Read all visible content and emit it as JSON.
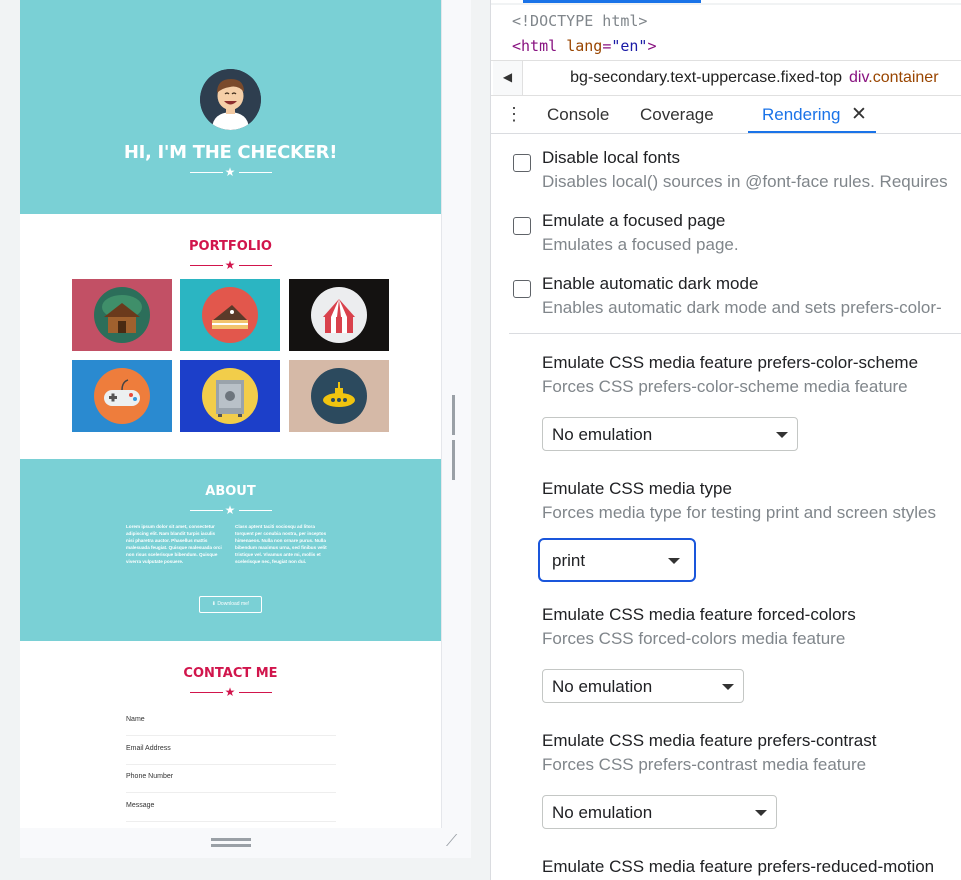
{
  "preview": {
    "hero": {
      "title": "HI, I'M THE CHECKER!",
      "background": "#7ad0d5"
    },
    "portfolio": {
      "title": "PORTFOLIO",
      "tiles": [
        {
          "icon": "cabin-icon",
          "bg": "#c25065"
        },
        {
          "icon": "cake-icon",
          "bg": "#2bb5c2"
        },
        {
          "icon": "circus-tent-icon",
          "bg": "#141211"
        },
        {
          "icon": "game-controller-icon",
          "bg": "#2a8ad0"
        },
        {
          "icon": "safe-icon",
          "bg": "#1c3fc9"
        },
        {
          "icon": "submarine-icon",
          "bg": "#d5b9a7"
        }
      ]
    },
    "about": {
      "title": "ABOUT",
      "col_left": "Lorem ipsum dolor sit amet, consectetur adipiscing elit. Nam blandit turpis iaculis nisi pharetra auctor. Phasellus mattis malesuada feugiat. Quisque malesuada orci non risus scelerisque bibendum. Quisque viverra vulputate posuere.",
      "col_right": "Class aptent taciti sociosqu ad litora torquent per conubia nostra, per inceptos himenaeos. Nulla non ornare purus. Nulla bibendum maximus urna, sed finibus velit tristique vel. Vivamus ante mi, mollis et scelerisque nec, feugiat non dui.",
      "button": "Download me!"
    },
    "contact": {
      "title": "CONTACT ME",
      "fields": [
        "Name",
        "Email Address",
        "Phone Number",
        "Message"
      ]
    }
  },
  "devtools": {
    "code_doctype": "<!DOCTYPE html>",
    "code_html_tag": "<html",
    "code_html_attr": "lang",
    "code_html_val": "\"en\"",
    "code_html_close": ">",
    "breadcrumb_prev": "bg-secondary.text-uppercase.fixed-top",
    "breadcrumb_current_tag": "div",
    "breadcrumb_current_class": ".container",
    "drawer_tabs": [
      "Console",
      "Coverage",
      "Rendering"
    ],
    "active_tab": "Rendering",
    "checkboxes": [
      {
        "title": "Disable local fonts",
        "desc": "Disables local() sources in @font-face rules. Requires"
      },
      {
        "title": "Emulate a focused page",
        "desc": "Emulates a focused page."
      },
      {
        "title": "Enable automatic dark mode",
        "desc": "Enables automatic dark mode and sets prefers-color-"
      }
    ],
    "media": [
      {
        "title": "Emulate CSS media feature prefers-color-scheme",
        "desc": "Forces CSS prefers-color-scheme media feature",
        "value": "No emulation"
      },
      {
        "title": "Emulate CSS media type",
        "desc": "Forces media type for testing print and screen styles",
        "value": "print"
      },
      {
        "title": "Emulate CSS media feature forced-colors",
        "desc": "Forces CSS forced-colors media feature",
        "value": "No emulation"
      },
      {
        "title": "Emulate CSS media feature prefers-contrast",
        "desc": "Forces CSS prefers-contrast media feature",
        "value": "No emulation"
      },
      {
        "title": "Emulate CSS media feature prefers-reduced-motion"
      }
    ],
    "accent": "#1a73e8"
  }
}
